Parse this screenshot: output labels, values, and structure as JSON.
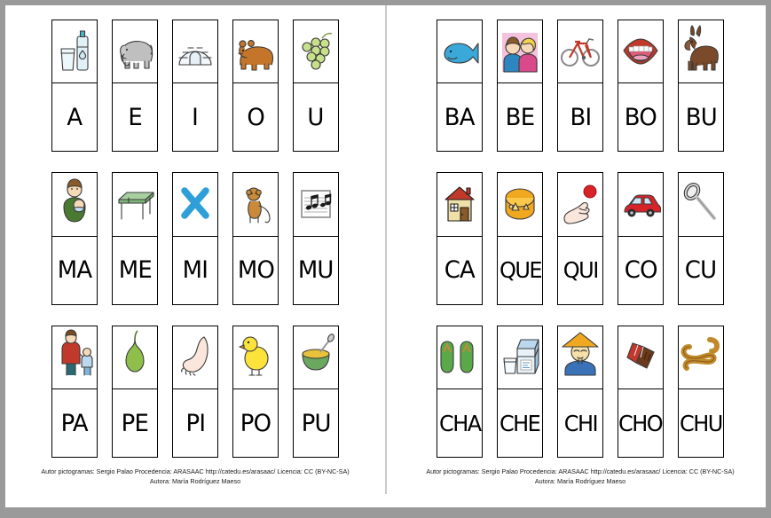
{
  "document": {
    "title": "Silabas con pictogramas ARASAAC",
    "page_bg": "#ffffff",
    "surround_bg": "#9a9a9a",
    "divider_color": "#c9c9c9"
  },
  "footer": {
    "line1": "Autor pictogramas: Sergio Palao Procedencia: ARASAAC http://catedu.es/arasaac/ Licencia: CC (BY-NC-SA)",
    "line2": "Autora: María Rodríguez Maeso"
  },
  "pages": [
    {
      "name": "left-page",
      "rows": [
        {
          "name": "row-vowels",
          "cards": [
            {
              "letter": "A",
              "icon": "water-bottle-glass-icon",
              "word": "agua"
            },
            {
              "letter": "E",
              "icon": "elephant-icon",
              "word": "elefante"
            },
            {
              "letter": "I",
              "icon": "igloo-icon",
              "word": "iglu"
            },
            {
              "letter": "O",
              "icon": "bear-icon",
              "word": "oso"
            },
            {
              "letter": "U",
              "icon": "grapes-icon",
              "word": "uvas"
            }
          ]
        },
        {
          "name": "row-m",
          "cards": [
            {
              "letter": "MA",
              "icon": "mother-baby-icon",
              "word": "mama"
            },
            {
              "letter": "ME",
              "icon": "table-icon",
              "word": "mesa"
            },
            {
              "letter": "MI",
              "icon": "blue-cross-icon",
              "word": "mi"
            },
            {
              "letter": "MO",
              "icon": "monkey-icon",
              "word": "mono"
            },
            {
              "letter": "MU",
              "icon": "music-notes-icon",
              "word": "musica"
            }
          ]
        },
        {
          "name": "row-p",
          "cards": [
            {
              "letter": "PA",
              "icon": "father-child-icon",
              "word": "papa"
            },
            {
              "letter": "PE",
              "icon": "pear-icon",
              "word": "pera"
            },
            {
              "letter": "PI",
              "icon": "foot-icon",
              "word": "pie"
            },
            {
              "letter": "PO",
              "icon": "chick-icon",
              "word": "pollito"
            },
            {
              "letter": "PU",
              "icon": "bowl-puree-icon",
              "word": "pure"
            }
          ]
        }
      ]
    },
    {
      "name": "right-page",
      "rows": [
        {
          "name": "row-b",
          "cards": [
            {
              "letter": "BA",
              "icon": "whale-icon",
              "word": "ballena"
            },
            {
              "letter": "BE",
              "icon": "kiss-icon",
              "word": "beso"
            },
            {
              "letter": "BI",
              "icon": "bicycle-icon",
              "word": "bicicleta"
            },
            {
              "letter": "BO",
              "icon": "mouth-icon",
              "word": "boca"
            },
            {
              "letter": "BU",
              "icon": "donkey-icon",
              "word": "burro"
            }
          ]
        },
        {
          "name": "row-c-qu",
          "cards": [
            {
              "letter": "CA",
              "icon": "house-icon",
              "word": "casa"
            },
            {
              "letter": "QUE",
              "icon": "cheese-icon",
              "word": "queso"
            },
            {
              "letter": "QUI",
              "icon": "hand-ball-icon",
              "word": "quiero"
            },
            {
              "letter": "CO",
              "icon": "car-icon",
              "word": "coche"
            },
            {
              "letter": "CU",
              "icon": "spoon-icon",
              "word": "cuchara"
            }
          ]
        },
        {
          "name": "row-ch",
          "cards": [
            {
              "letter": "CHA",
              "icon": "flip-flops-icon",
              "word": "chanclas"
            },
            {
              "letter": "CHE",
              "icon": "milk-carton-icon",
              "word": "leche"
            },
            {
              "letter": "CHI",
              "icon": "chinese-man-icon",
              "word": "chino"
            },
            {
              "letter": "CHO",
              "icon": "chocolate-bar-icon",
              "word": "chocolate"
            },
            {
              "letter": "CHU",
              "icon": "churros-icon",
              "word": "churros"
            }
          ]
        }
      ]
    }
  ]
}
